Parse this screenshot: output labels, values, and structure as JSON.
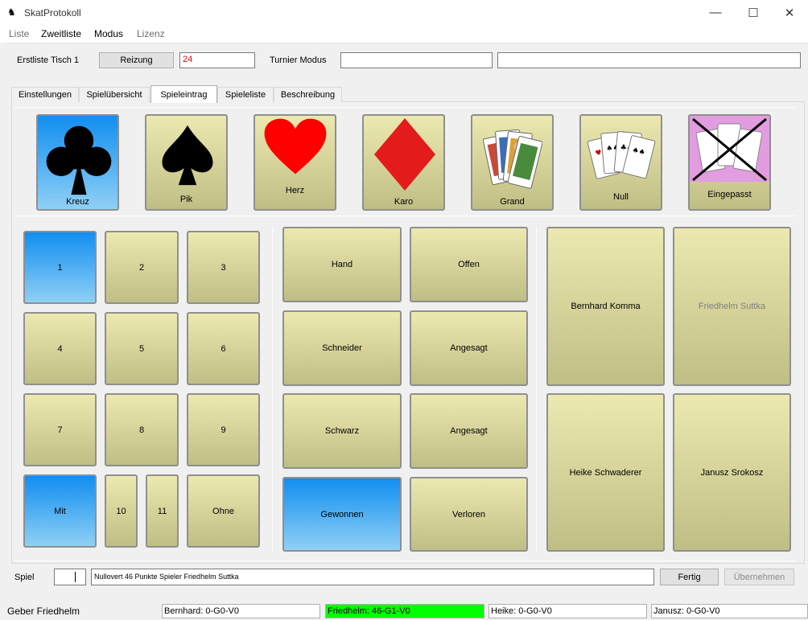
{
  "window": {
    "title": "SkatProtokoll",
    "minimize": "—",
    "maximize": "☐",
    "close": "✕"
  },
  "menu": [
    "Liste",
    "Zweitliste",
    "Modus",
    "Lizenz"
  ],
  "top": {
    "table_label": "Erstliste Tisch 1",
    "reizung_button": "Reizung",
    "reizung_value": "24",
    "turnier_label": "Turnier Modus",
    "turnier_field1": "",
    "turnier_field2": ""
  },
  "tabs": [
    "Einstellungen",
    "Spielübersicht",
    "Spieleintrag",
    "Spieleliste",
    "Beschreibung"
  ],
  "active_tab": "Spieleintrag",
  "game_types": [
    {
      "label": "Kreuz",
      "icon": "club-icon",
      "selected": true
    },
    {
      "label": "Pik",
      "icon": "spade-icon",
      "selected": false
    },
    {
      "label": "Herz",
      "icon": "heart-icon",
      "selected": false
    },
    {
      "label": "Karo",
      "icon": "diamond-icon",
      "selected": false
    },
    {
      "label": "Grand",
      "icon": "grand-cards-icon",
      "selected": false
    },
    {
      "label": "Null",
      "icon": "null-cards-icon",
      "selected": false
    },
    {
      "label": "Eingepasst",
      "icon": "crossed-cards-icon",
      "selected": false
    }
  ],
  "numbers": [
    "1",
    "2",
    "3",
    "4",
    "5",
    "6",
    "7",
    "8",
    "9",
    "Mit",
    "10",
    "11",
    "Ohne"
  ],
  "number_selected": [
    "1",
    "Mit"
  ],
  "options": {
    "hand": "Hand",
    "offen": "Offen",
    "schneider": "Schneider",
    "schneider_angesagt": "Angesagt",
    "schwarz": "Schwarz",
    "schwarz_angesagt": "Angesagt",
    "gewonnen": "Gewonnen",
    "verloren": "Verloren"
  },
  "players": [
    {
      "name": "Bernhard Komma",
      "dimmed": false
    },
    {
      "name": "Friedhelm Suttka",
      "dimmed": true
    },
    {
      "name": "Heike Schwaderer",
      "dimmed": false
    },
    {
      "name": "Janusz Srokosz",
      "dimmed": false
    }
  ],
  "bottom": {
    "spiel_label": "Spiel",
    "spiel_number": "",
    "description": "Nullovert 46 Punkte Spieler Friedhelm Suttka",
    "fertig": "Fertig",
    "uebernehmen": "Übernehmen"
  },
  "status": {
    "geber": "Geber Friedhelm",
    "cells": [
      "Bernhard: 0-G0-V0",
      "Friedhelm: 46-G1-V0",
      "Heike: 0-G0-V0",
      "Janusz: 0-G0-V0"
    ],
    "highlight_color": "#00ff00"
  },
  "colors": {
    "selected": "#118ef0",
    "tile": "#ece9b0",
    "heart": "#ff0000",
    "diamond": "#e31b1b"
  }
}
